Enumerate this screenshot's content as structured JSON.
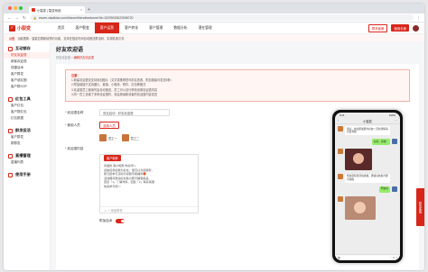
{
  "browser": {
    "tab_title": "小裂变 | 裂变系统",
    "url": "escrm.xiaolbian.com/#/scrm/friend/welcome?id=10299033022908720"
  },
  "topnav": {
    "logo": "小裂变",
    "items": [
      "首页",
      "客户裂变",
      "客户运营",
      "客户转化",
      "客户管理",
      "数据分析",
      "潜在管理"
    ],
    "active_index": 2,
    "btn_primary": "使用手册",
    "btn_outline": "联系客服"
  },
  "notice": {
    "tag": "公告",
    "text": "功能更新：智能拉群新增预约功能，支持在指定时间自动推送群活码，实现精准引流"
  },
  "sidebar": {
    "groups": [
      {
        "title": "互动锁存",
        "items": [
          "好友欢迎语",
          "新客欢迎语",
          "快捷话术",
          "客户群发",
          "客户朋友圈",
          "客户群SOP"
        ],
        "active": 0
      },
      {
        "title": "红包工具",
        "items": [
          "客户红包",
          "客户群红包",
          "红包数据"
        ],
        "active": -1
      },
      {
        "title": "群发促活",
        "items": [
          "客户群发",
          "群群发"
        ],
        "active": -1
      },
      {
        "title": "直播管理",
        "items": [
          "直播列表"
        ],
        "active": -1
      },
      {
        "title": "使用手册",
        "items": [],
        "active": -1
      }
    ]
  },
  "page": {
    "title": "好友欢迎语",
    "crumb_parent": "好友欢迎语",
    "crumb_current": "编辑好友欢迎语"
  },
  "tips": {
    "title": "注意：",
    "lines": [
      "1.新建欢迎语仅支持添加图片（文字类推荐您可前往查看，附加链接可发送5条）",
      "2.附加链接只支持图片、链接、小程序、附件、红包等格式",
      "3.欢迎语员工使用时会自动推送，员工可以自行修改设置欢迎语内容",
      "4.同一员工设置了多条欢迎语时，将会按最新设置的欢迎语内容发送"
    ]
  },
  "form": {
    "name_label": "欢迎语名称",
    "name_value": "双旦启动 - 好友欢迎语",
    "staff_label": "使用人员",
    "select_btn": "选择人员",
    "staff": [
      "员工一",
      "员工二"
    ],
    "content_label": "欢迎语内容",
    "editor_pill": "客户昵称",
    "editor_lines": [
      "亲爱的 客户昵称 你好呀～",
      "感谢您添加我为好友，很高兴为您服务，",
      "即日起参与活动可领取专属福利🎁",
      "活动期间邀请好友助力即可解锁奖品",
      "回复「1」了解详情，回复「2」联系客服",
      "快来参与吧～"
    ],
    "editor_foot": "☺ + 添加附件",
    "switch_label": "附加话术",
    "switch_on": true
  },
  "phone": {
    "time": "9:41",
    "battery": "100%",
    "title": "小裂变",
    "msgs": [
      "您好，欢迎添加我为好友～活动详情请点击查看",
      "好的，谢谢！",
      "恭喜您获得活动资格，邀请好友助力即可领取",
      "明白啦"
    ],
    "input_icons": "☺ +"
  },
  "float_btn": "联系客服"
}
